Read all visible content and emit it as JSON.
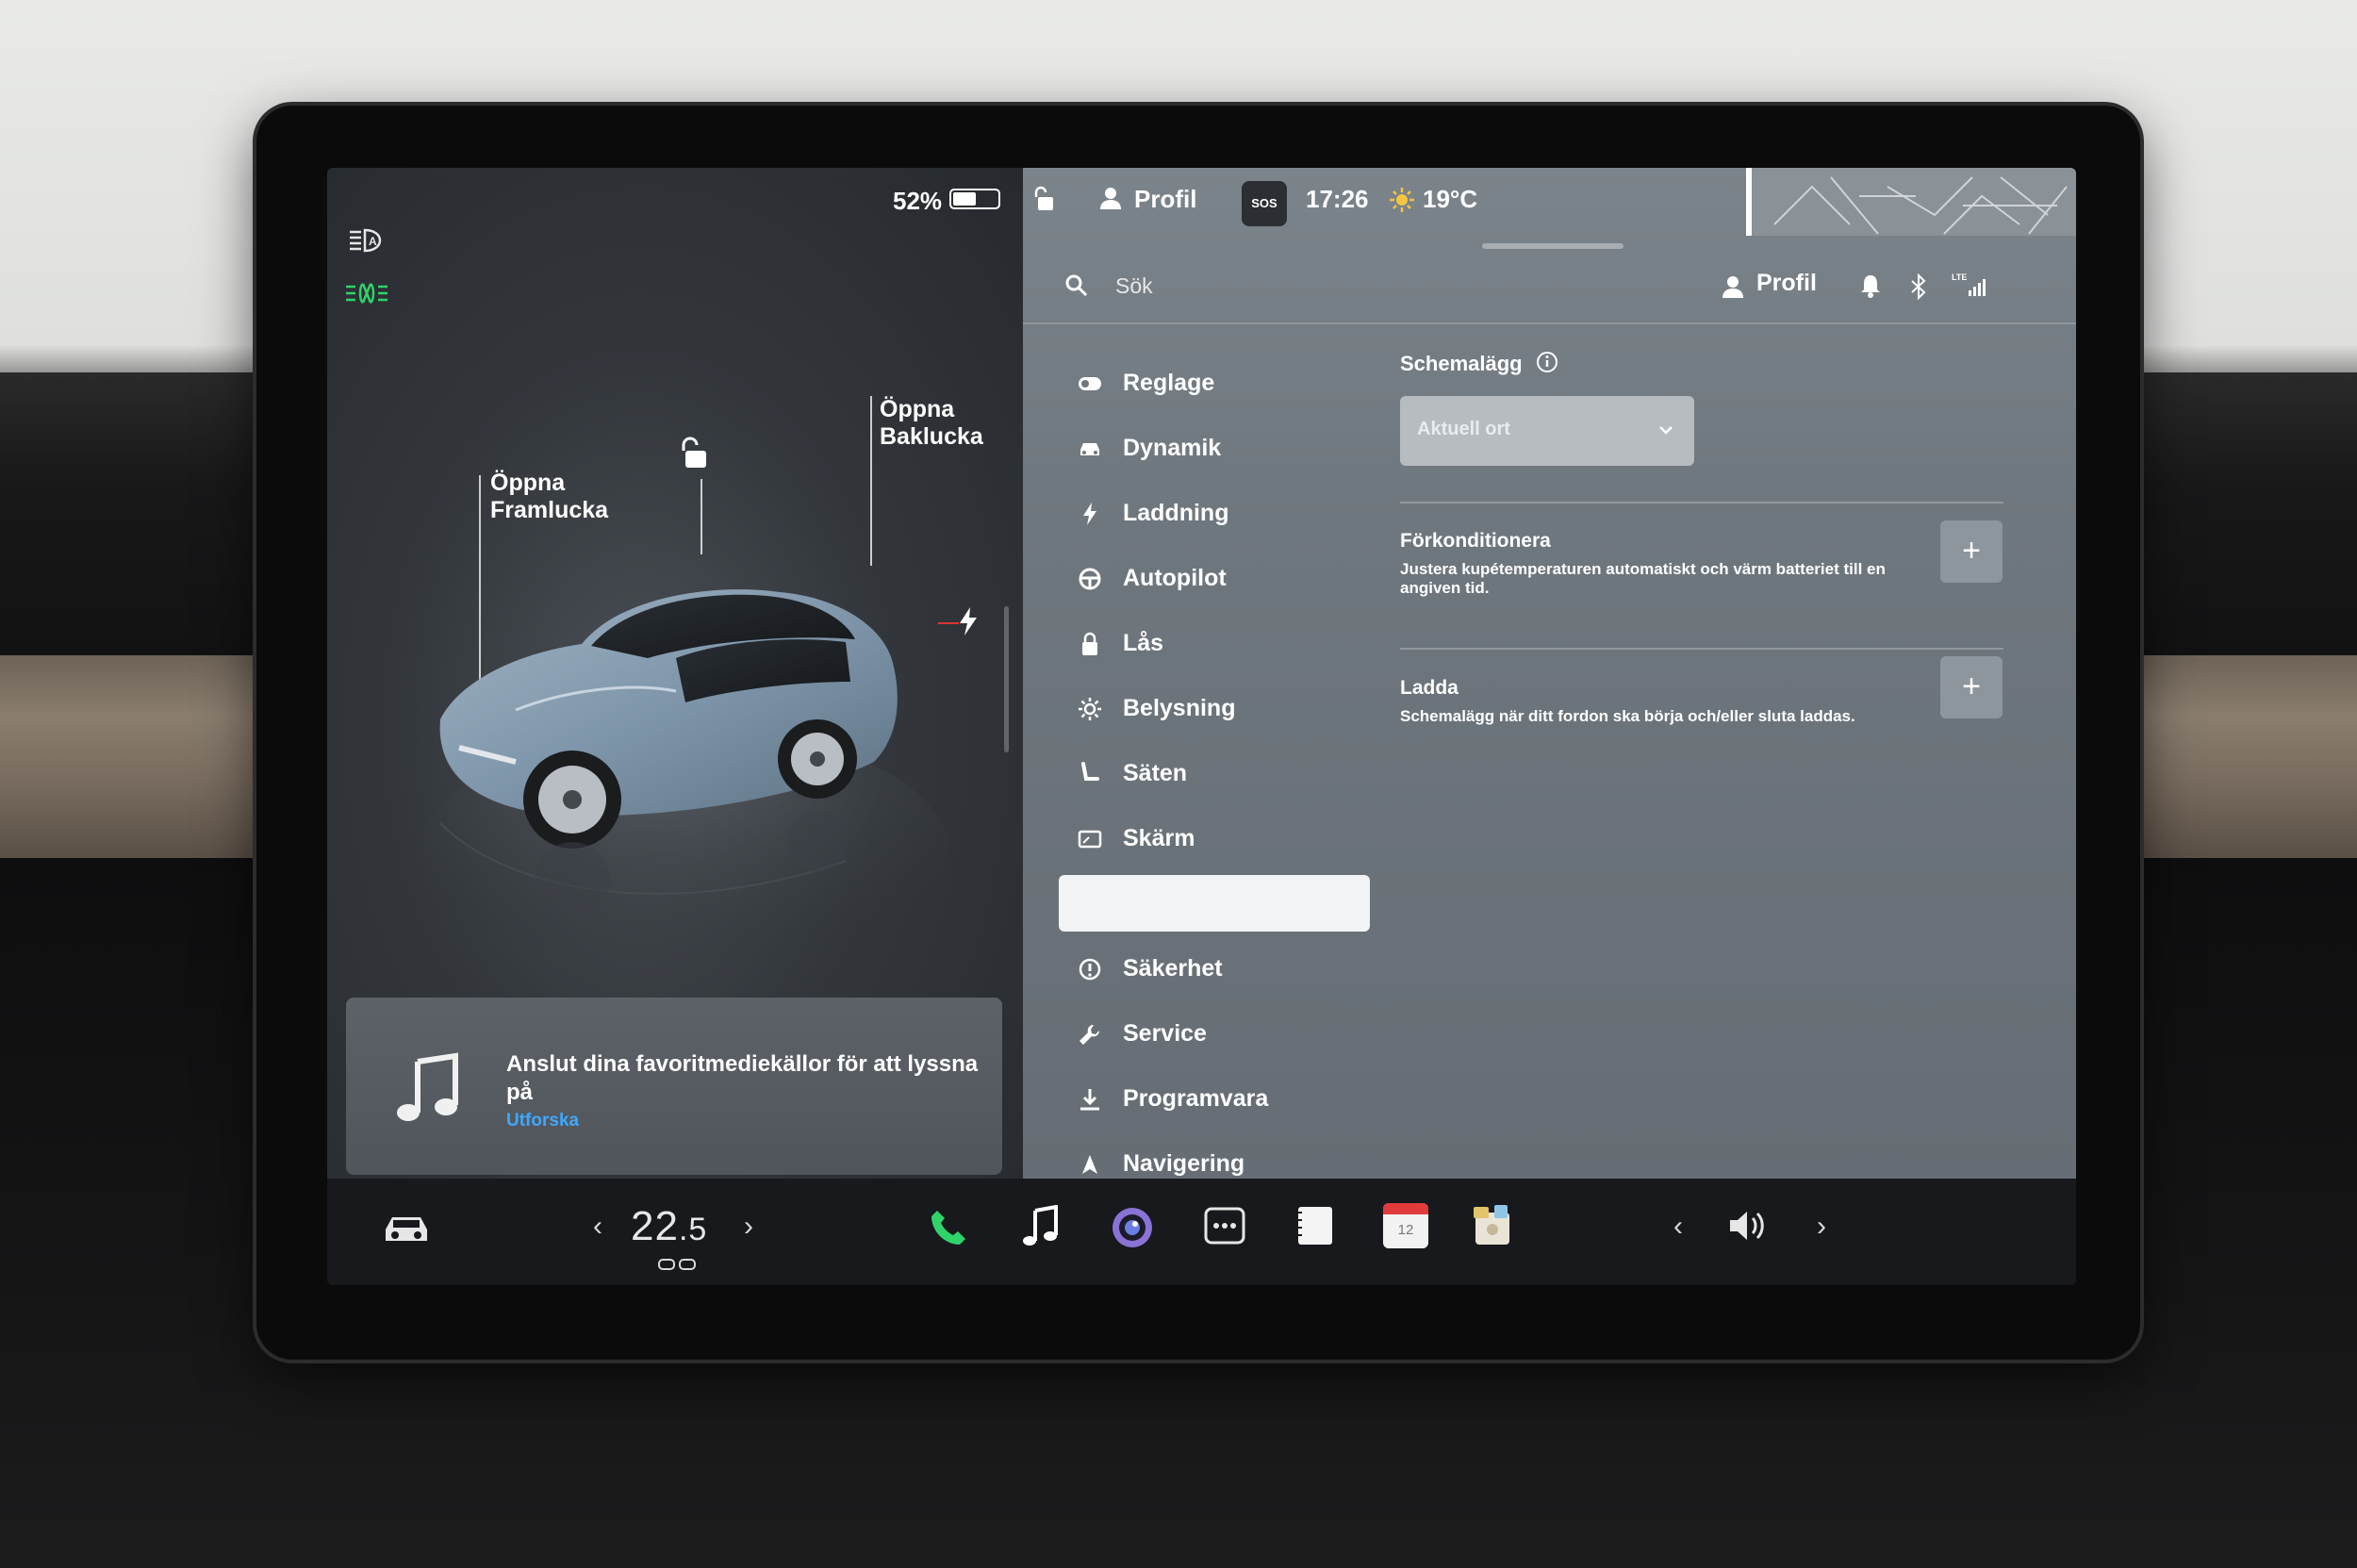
{
  "status": {
    "battery_pct": "52%",
    "battery_level": 0.52
  },
  "car_panel": {
    "front_label": "Öppna\nFramlucka",
    "front_label_l1": "Öppna",
    "front_label_l2": "Framlucka",
    "rear_label_l1": "Öppna",
    "rear_label_l2": "Baklucka",
    "icons": [
      "headlight-auto-icon",
      "fog-light-icon",
      "unlock-icon",
      "charge-bolt-icon"
    ]
  },
  "media": {
    "title": "Anslut dina favoritmediekällor för att lyssna på",
    "link": "Utforska"
  },
  "top_status": {
    "profile": "Profil",
    "sos": "SOS",
    "time": "17:26",
    "temperature": "19°C"
  },
  "header": {
    "search_placeholder": "Sök",
    "profile": "Profil",
    "signal": "LTE"
  },
  "menu": {
    "items": [
      {
        "label": "Reglage",
        "icon": "toggle-icon"
      },
      {
        "label": "Dynamik",
        "icon": "car-icon"
      },
      {
        "label": "Laddning",
        "icon": "bolt-icon"
      },
      {
        "label": "Autopilot",
        "icon": "steering-wheel-icon"
      },
      {
        "label": "Lås",
        "icon": "lock-icon"
      },
      {
        "label": "Belysning",
        "icon": "sun-icon"
      },
      {
        "label": "Säten",
        "icon": "seat-icon"
      },
      {
        "label": "Skärm",
        "icon": "display-icon"
      },
      {
        "label": "",
        "icon": "calendar-icon",
        "active": true
      },
      {
        "label": "Säkerhet",
        "icon": "shield-alert-icon"
      },
      {
        "label": "Service",
        "icon": "wrench-icon"
      },
      {
        "label": "Programvara",
        "icon": "download-icon"
      },
      {
        "label": "Navigering",
        "icon": "navigation-icon"
      }
    ]
  },
  "schedule": {
    "title": "Schemalägg",
    "location_select": "Aktuell ort",
    "precondition_title": "Förkonditionera",
    "precondition_desc": "Justera kupétemperaturen automatiskt och värm batteriet till en angiven tid.",
    "charge_title": "Ladda",
    "charge_desc": "Schemalägg när ditt fordon ska börja och/eller sluta laddas.",
    "add_label": "+"
  },
  "bottom_bar": {
    "temp_whole": "22",
    "temp_decimal": ".5",
    "calendar_day": "12",
    "prev": "‹",
    "next": "›"
  },
  "colors": {
    "accent_green": "#2fd36a",
    "link_blue": "#3fa8ff",
    "phone_green": "#2fd36a",
    "calendar_red": "#e23b3b"
  }
}
